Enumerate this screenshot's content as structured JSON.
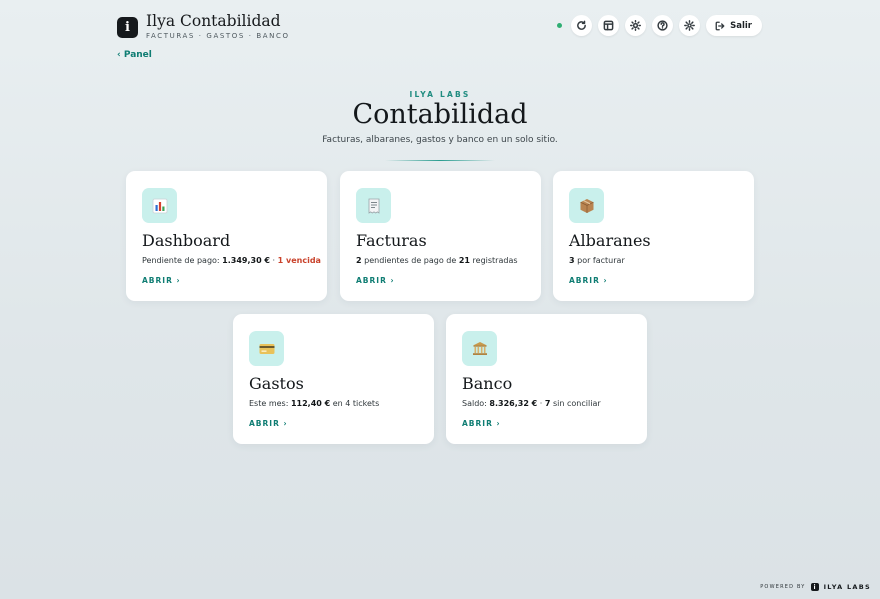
{
  "header": {
    "logo_letter": "i",
    "title": "Ilya Contabilidad",
    "subtitle": "FACTURAS · GASTOS · BANCO",
    "back_link": "‹ Panel",
    "logout_label": "Salir",
    "status_color": "#2fae73",
    "toolbar_icons": [
      "refresh-icon",
      "layout-icon",
      "sun-icon",
      "help-icon",
      "gear-icon",
      "logout-icon"
    ]
  },
  "hero": {
    "eyebrow": "ILYA LABS",
    "title": "Contabilidad",
    "subtitle": "Facturas, albaranes, gastos y banco en un solo sitio."
  },
  "cards": [
    {
      "icon": "chart-icon",
      "title": "Dashboard",
      "desc": [
        {
          "text": "Pendiente de pago: ",
          "style": "normal"
        },
        {
          "text": "1.349,30 €",
          "style": "bold"
        },
        {
          "text": " · ",
          "style": "normal"
        },
        {
          "text": "1 vencida",
          "style": "alert"
        }
      ],
      "link": "ABRIR ›"
    },
    {
      "icon": "receipt-icon",
      "title": "Facturas",
      "desc": [
        {
          "text": "2",
          "style": "bold"
        },
        {
          "text": " pendientes de pago de ",
          "style": "normal"
        },
        {
          "text": "21",
          "style": "bold"
        },
        {
          "text": " registradas",
          "style": "normal"
        }
      ],
      "link": "ABRIR ›"
    },
    {
      "icon": "package-icon",
      "title": "Albaranes",
      "desc": [
        {
          "text": "3",
          "style": "bold"
        },
        {
          "text": " por facturar",
          "style": "normal"
        }
      ],
      "link": "ABRIR ›"
    },
    {
      "icon": "credit-card-icon",
      "title": "Gastos",
      "desc": [
        {
          "text": "Este mes: ",
          "style": "normal"
        },
        {
          "text": "112,40 €",
          "style": "bold"
        },
        {
          "text": " en 4 tickets",
          "style": "normal"
        }
      ],
      "link": "ABRIR ›"
    },
    {
      "icon": "bank-icon",
      "title": "Banco",
      "desc": [
        {
          "text": "Saldo: ",
          "style": "normal"
        },
        {
          "text": "8.326,32 €",
          "style": "bold"
        },
        {
          "text": " · ",
          "style": "normal"
        },
        {
          "text": "7",
          "style": "bold"
        },
        {
          "text": " sin conciliar",
          "style": "normal"
        }
      ],
      "link": "ABRIR ›"
    }
  ],
  "footer": {
    "powered_by": "POWERED BY",
    "brand": "ILYA LABS",
    "mini_logo": "i"
  },
  "colors": {
    "accent": "#0f7d73",
    "alert": "#c9422b",
    "icon_tile": "#c9f0ec"
  }
}
